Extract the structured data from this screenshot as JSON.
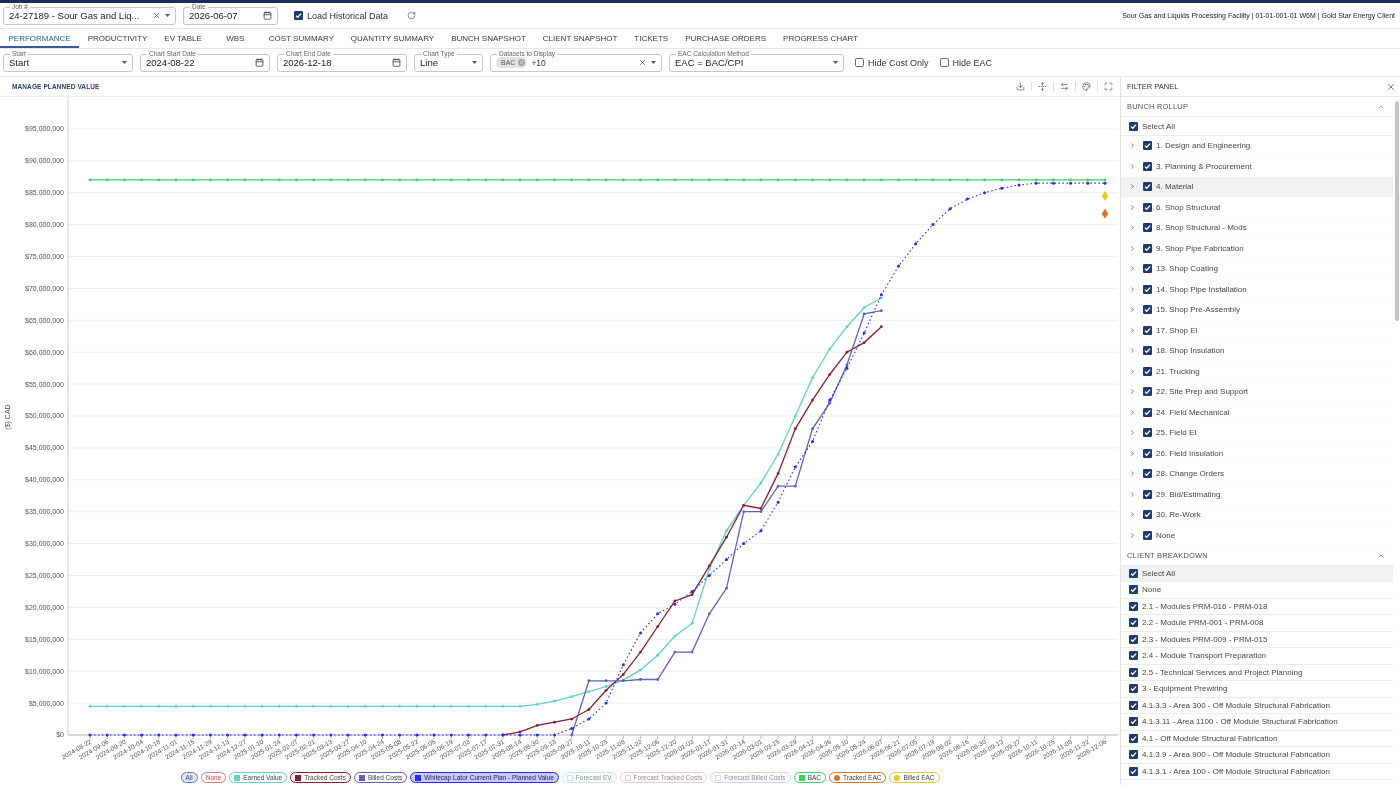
{
  "header": {
    "fields": [
      {
        "kind": "combobox",
        "label": "Job #",
        "value": "24-27189 - Sour Gas and Liq..."
      },
      {
        "kind": "date",
        "label": "Date",
        "value": "2026-06-07"
      },
      {
        "kind": "checkbox",
        "label": "Load Historical Data",
        "checked": true
      }
    ],
    "project_info": "Sour Gas and Liquids Processing Facility | 01-01-001-01 W6M | Gold Star Energy Client"
  },
  "tabs": [
    {
      "label": "PERFORMANCE",
      "selected": true
    },
    {
      "label": "PRODUCTIVITY",
      "selected": false
    },
    {
      "label": "EV TABLE",
      "selected": false
    },
    {
      "label": "WBS",
      "selected": false
    },
    {
      "label": "COST SUMMARY",
      "selected": false
    },
    {
      "label": "QUANTITY SUMMARY",
      "selected": false
    },
    {
      "label": "BUNCH SNAPSHOT",
      "selected": false
    },
    {
      "label": "CLIENT SNAPSHOT",
      "selected": false
    },
    {
      "label": "TICKETS",
      "selected": false
    },
    {
      "label": "PURCHASE ORDERS",
      "selected": false
    },
    {
      "label": "PROGRESS CHART",
      "selected": false
    }
  ],
  "controls": [
    {
      "kind": "select",
      "label": "Start",
      "value": "Start"
    },
    {
      "kind": "date",
      "label": "Chart Start Date",
      "value": "2024-08-22"
    },
    {
      "kind": "date",
      "label": "Chart End Date",
      "value": "2026-12-18"
    },
    {
      "kind": "select",
      "label": "Chart Type",
      "value": "Line"
    },
    {
      "kind": "multiselect",
      "label": "Datasets to Display",
      "chips": [
        "BAC"
      ],
      "more": "+10"
    },
    {
      "kind": "select",
      "label": "EAC Calculation Method",
      "value": "EAC = BAC/CPI"
    },
    {
      "kind": "checkbox",
      "label": "Hide Cost Only",
      "checked": false
    },
    {
      "kind": "checkbox",
      "label": "Hide EAC",
      "checked": false
    }
  ],
  "chart": {
    "link": "MANAGE PLANNED VALUE",
    "legend_buttons": [
      {
        "label": "All",
        "kind": "all"
      },
      {
        "label": "None",
        "kind": "none"
      }
    ],
    "legend_items": [
      {
        "shown": true,
        "highlighted": false
      },
      {
        "shown": true,
        "highlighted": false
      },
      {
        "shown": true,
        "highlighted": false
      },
      {
        "shown": true,
        "highlighted": true
      },
      {
        "label": "Forecast EV",
        "color": "#c2ece7",
        "shown": false,
        "highlighted": false
      },
      {
        "label": "Forecast Tracked Costs",
        "color": "#efc8cc",
        "shown": false,
        "highlighted": false
      },
      {
        "label": "Forecast Billed Costs",
        "color": "#d3d5f0",
        "shown": false,
        "highlighted": false
      },
      {
        "shown": true,
        "highlighted": false
      },
      {
        "shown": true,
        "highlighted": false
      },
      {
        "shown": true,
        "highlighted": false
      }
    ],
    "chart_data": {
      "type": "line",
      "ylabel": "($) CAD",
      "ylim": [
        0,
        100000000
      ],
      "grid": true,
      "yticks": [
        {
          "value": 0,
          "label": "$0"
        },
        {
          "value": 5000000,
          "label": "$5,000,000"
        },
        {
          "value": 10000000,
          "label": "$10,000,000"
        },
        {
          "value": 15000000,
          "label": "$15,000,000"
        },
        {
          "value": 20000000,
          "label": "$20,000,000"
        },
        {
          "value": 25000000,
          "label": "$25,000,000"
        },
        {
          "value": 30000000,
          "label": "$30,000,000"
        },
        {
          "value": 35000000,
          "label": "$35,000,000"
        },
        {
          "value": 40000000,
          "label": "$40,000,000"
        },
        {
          "value": 45000000,
          "label": "$45,000,000"
        },
        {
          "value": 50000000,
          "label": "$50,000,000"
        },
        {
          "value": 55000000,
          "label": "$55,000,000"
        },
        {
          "value": 60000000,
          "label": "$60,000,000"
        },
        {
          "value": 65000000,
          "label": "$65,000,000"
        },
        {
          "value": 70000000,
          "label": "$70,000,000"
        },
        {
          "value": 75000000,
          "label": "$75,000,000"
        },
        {
          "value": 80000000,
          "label": "$80,000,000"
        },
        {
          "value": 85000000,
          "label": "$85,000,000"
        },
        {
          "value": 90000000,
          "label": "$90,000,000"
        },
        {
          "value": 95000000,
          "label": "$95,000,000"
        }
      ],
      "x": [
        "2024-08-22",
        "2024-09-06",
        "2024-09-20",
        "2024-10-04",
        "2024-10-18",
        "2024-11-01",
        "2024-11-15",
        "2024-11-29",
        "2024-12-13",
        "2024-12-27",
        "2025-01-10",
        "2025-01-24",
        "2025-02-07",
        "2025-02-21",
        "2025-03-13",
        "2025-03-27",
        "2025-04-10",
        "2025-04-24",
        "2025-05-08",
        "2025-05-22",
        "2025-06-05",
        "2025-06-19",
        "2025-07-03",
        "2025-07-17",
        "2025-07-31",
        "2025-08-14",
        "2025-08-30",
        "2025-09-13",
        "2025-09-27",
        "2025-10-11",
        "2025-10-25",
        "2025-11-08",
        "2025-11-22",
        "2025-12-06",
        "2025-12-20",
        "2026-01-03",
        "2026-01-17",
        "2026-01-31",
        "2026-02-14",
        "2026-03-01",
        "2026-03-15",
        "2026-03-29",
        "2026-04-12",
        "2026-04-26",
        "2026-05-10",
        "2026-05-24",
        "2026-06-07",
        "2026-06-21",
        "2026-07-05",
        "2026-07-19",
        "2026-08-02",
        "2026-08-16",
        "2026-08-30",
        "2026-09-13",
        "2026-09-27",
        "2026-10-11",
        "2026-10-25",
        "2026-11-08",
        "2026-11-22",
        "2026-12-06"
      ],
      "series": [
        {
          "name": "Earned Value",
          "color": "#62d0c5",
          "line_style": "solid",
          "values": [
            4500000,
            4500000,
            4500000,
            4500000,
            4500000,
            4500000,
            4500000,
            4500000,
            4500000,
            4500000,
            4500000,
            4500000,
            4500000,
            4500000,
            4500000,
            4500000,
            4500000,
            4500000,
            4500000,
            4500000,
            4500000,
            4500000,
            4500000,
            4500000,
            4500000,
            4500000,
            4800000,
            5300000,
            6000000,
            6800000,
            7600000,
            8600000,
            10200000,
            12500000,
            15500000,
            17500000,
            26000000,
            32000000,
            36000000,
            39500000,
            44000000,
            50000000,
            56000000,
            60500000,
            64000000,
            67000000,
            68500000,
            null,
            null,
            null,
            null,
            null,
            null,
            null,
            null,
            null,
            null,
            null,
            null,
            null
          ]
        },
        {
          "name": "Tracked Costs",
          "color": "#8b1f2f",
          "line_style": "solid",
          "values": [
            null,
            null,
            null,
            null,
            null,
            null,
            null,
            null,
            null,
            null,
            null,
            null,
            null,
            null,
            null,
            null,
            null,
            null,
            null,
            null,
            null,
            null,
            null,
            null,
            0,
            500000,
            1500000,
            2000000,
            2500000,
            4000000,
            7000000,
            9500000,
            13000000,
            17000000,
            21000000,
            22000000,
            26500000,
            31000000,
            36000000,
            35500000,
            41000000,
            48000000,
            52500000,
            56500000,
            60000000,
            61500000,
            64000000,
            null,
            null,
            null,
            null,
            null,
            null,
            null,
            null,
            null,
            null,
            null,
            null,
            null
          ]
        },
        {
          "name": "Billed Costs",
          "color": "#5b64bd",
          "line_style": "solid",
          "values": [
            null,
            null,
            null,
            null,
            null,
            null,
            null,
            null,
            null,
            null,
            null,
            null,
            null,
            null,
            null,
            null,
            null,
            null,
            null,
            null,
            null,
            null,
            null,
            null,
            null,
            null,
            null,
            null,
            0,
            8500000,
            8500000,
            8500000,
            8700000,
            8700000,
            13000000,
            13000000,
            19000000,
            23000000,
            35000000,
            35000000,
            39000000,
            39000000,
            48000000,
            52000000,
            58000000,
            66000000,
            66500000,
            null,
            null,
            null,
            null,
            null,
            null,
            null,
            null,
            null,
            null,
            null,
            null,
            null
          ]
        },
        {
          "name": "Whitecap Lator Current Plan - Planned Value",
          "color": "#2a2ae8",
          "line_style": "dotted",
          "values": [
            0,
            0,
            0,
            0,
            0,
            0,
            0,
            0,
            0,
            0,
            0,
            0,
            0,
            0,
            0,
            0,
            0,
            0,
            0,
            0,
            0,
            0,
            0,
            0,
            0,
            0,
            0,
            0,
            1000000,
            2500000,
            5000000,
            11000000,
            16000000,
            19000000,
            20500000,
            22500000,
            25000000,
            27500000,
            30000000,
            32000000,
            36500000,
            42000000,
            46000000,
            52500000,
            57500000,
            63000000,
            69000000,
            73500000,
            77000000,
            80000000,
            82500000,
            84000000,
            85000000,
            85700000,
            86200000,
            86500000,
            86500000,
            86500000,
            86500000,
            86500000
          ]
        },
        {
          "name": "BAC",
          "color": "#3ecf62",
          "line_style": "solid",
          "values": [
            87000000,
            87000000,
            87000000,
            87000000,
            87000000,
            87000000,
            87000000,
            87000000,
            87000000,
            87000000,
            87000000,
            87000000,
            87000000,
            87000000,
            87000000,
            87000000,
            87000000,
            87000000,
            87000000,
            87000000,
            87000000,
            87000000,
            87000000,
            87000000,
            87000000,
            87000000,
            87000000,
            87000000,
            87000000,
            87000000,
            87000000,
            87000000,
            87000000,
            87000000,
            87000000,
            87000000,
            87000000,
            87000000,
            87000000,
            87000000,
            87000000,
            87000000,
            87000000,
            87000000,
            87000000,
            87000000,
            87000000,
            87000000,
            87000000,
            87000000,
            87000000,
            87000000,
            87000000,
            87000000,
            87000000,
            87000000,
            87000000,
            87000000,
            87000000,
            87000000
          ]
        },
        {
          "name": "Tracked EAC",
          "color": "#d9742b",
          "line_style": "none",
          "marker": "diamond",
          "values": [
            null,
            null,
            null,
            null,
            null,
            null,
            null,
            null,
            null,
            null,
            null,
            null,
            null,
            null,
            null,
            null,
            null,
            null,
            null,
            null,
            null,
            null,
            null,
            null,
            null,
            null,
            null,
            null,
            null,
            null,
            null,
            null,
            null,
            null,
            null,
            null,
            null,
            null,
            null,
            null,
            null,
            null,
            null,
            null,
            null,
            null,
            null,
            null,
            null,
            null,
            null,
            null,
            null,
            null,
            null,
            null,
            null,
            null,
            null,
            81700000
          ]
        },
        {
          "name": "Billed EAC",
          "color": "#e2cc2a",
          "line_style": "none",
          "marker": "diamond",
          "values": [
            null,
            null,
            null,
            null,
            null,
            null,
            null,
            null,
            null,
            null,
            null,
            null,
            null,
            null,
            null,
            null,
            null,
            null,
            null,
            null,
            null,
            null,
            null,
            null,
            null,
            null,
            null,
            null,
            null,
            null,
            null,
            null,
            null,
            null,
            null,
            null,
            null,
            null,
            null,
            null,
            null,
            null,
            null,
            null,
            null,
            null,
            null,
            null,
            null,
            null,
            null,
            null,
            null,
            null,
            null,
            null,
            null,
            null,
            null,
            84500000
          ]
        }
      ]
    }
  },
  "filter_panel": {
    "title": "FILTER PANEL",
    "sections": [
      {
        "title": "BUNCH ROLLUP",
        "kind": "tree",
        "expanded": true,
        "select_all": {
          "label": "Select All",
          "checked": true,
          "highlighted": false
        },
        "items": [
          {
            "label": "1. Design and Engineering",
            "checked": true,
            "expanded": false,
            "highlighted": false
          },
          {
            "label": "3. Planning & Procurement",
            "checked": true,
            "expanded": false,
            "highlighted": false
          },
          {
            "label": "4. Material",
            "checked": true,
            "expanded": false,
            "highlighted": true
          },
          {
            "label": "6. Shop Structural",
            "checked": true,
            "expanded": false,
            "highlighted": false
          },
          {
            "label": "8. Shop Structural - Mods",
            "checked": true,
            "expanded": false,
            "highlighted": false
          },
          {
            "label": "9. Shop Pipe Fabrication",
            "checked": true,
            "expanded": false,
            "highlighted": false
          },
          {
            "label": "13. Shop Coating",
            "checked": true,
            "expanded": false,
            "highlighted": false
          },
          {
            "label": "14. Shop Pipe Installation",
            "checked": true,
            "expanded": false,
            "highlighted": false
          },
          {
            "label": "15. Shop Pre-Assembly",
            "checked": true,
            "expanded": false,
            "highlighted": false
          },
          {
            "label": "17. Shop EI",
            "checked": true,
            "expanded": false,
            "highlighted": false
          },
          {
            "label": "18. Shop Insulation",
            "checked": true,
            "expanded": false,
            "highlighted": false
          },
          {
            "label": "21. Trucking",
            "checked": true,
            "expanded": false,
            "highlighted": false
          },
          {
            "label": "22. Site Prep and Support",
            "checked": true,
            "expanded": false,
            "highlighted": false
          },
          {
            "label": "24. Field Mechanical",
            "checked": true,
            "expanded": false,
            "highlighted": false
          },
          {
            "label": "25. Field EI",
            "checked": true,
            "expanded": false,
            "highlighted": false
          },
          {
            "label": "26. Field Insulation",
            "checked": true,
            "expanded": false,
            "highlighted": false
          },
          {
            "label": "28. Change Orders",
            "checked": true,
            "expanded": false,
            "highlighted": false
          },
          {
            "label": "29. Bid/Estimating",
            "checked": true,
            "expanded": false,
            "highlighted": false
          },
          {
            "label": "30. Re-Work",
            "checked": true,
            "expanded": false,
            "highlighted": false
          },
          {
            "label": "None",
            "checked": true,
            "expanded": false,
            "highlighted": false
          }
        ]
      },
      {
        "title": "CLIENT BREAKDOWN",
        "kind": "list",
        "expanded": true,
        "select_all": {
          "label": "Select All",
          "checked": true,
          "highlighted": true
        },
        "items": [
          {
            "label": "None",
            "checked": true,
            "highlighted": false
          },
          {
            "label": "2.1 - Modules PRM-016 - PRM-018",
            "checked": true,
            "highlighted": false
          },
          {
            "label": "2.2 - Module PRM-001 - PRM-008",
            "checked": true,
            "highlighted": false
          },
          {
            "label": "2.3 - Modules PRM-009 - PRM-015",
            "checked": true,
            "highlighted": false
          },
          {
            "label": "2.4 - Module Transport Preparation",
            "checked": true,
            "highlighted": false
          },
          {
            "label": "2.5 - Technical Services and Project Planning",
            "checked": true,
            "highlighted": false
          },
          {
            "label": "3 - Equipment Prewiring",
            "checked": true,
            "highlighted": false
          },
          {
            "label": "4.1.3.3 - Area 300 - Off Module Structural Fabrication",
            "checked": true,
            "highlighted": false
          },
          {
            "label": "4.1.3.11 - Area 1100 - Off Module Structural Fabrication",
            "checked": true,
            "highlighted": false
          },
          {
            "label": "4.1 - Off Module Structural Fabrication",
            "checked": true,
            "highlighted": false
          },
          {
            "label": "4.1.3.9 - Area 900 - Off Module Structural Fabrication",
            "checked": true,
            "highlighted": false
          },
          {
            "label": "4.1.3.1 - Area 100 - Off Module Structural Fabrication",
            "checked": true,
            "highlighted": false
          }
        ]
      }
    ]
  }
}
